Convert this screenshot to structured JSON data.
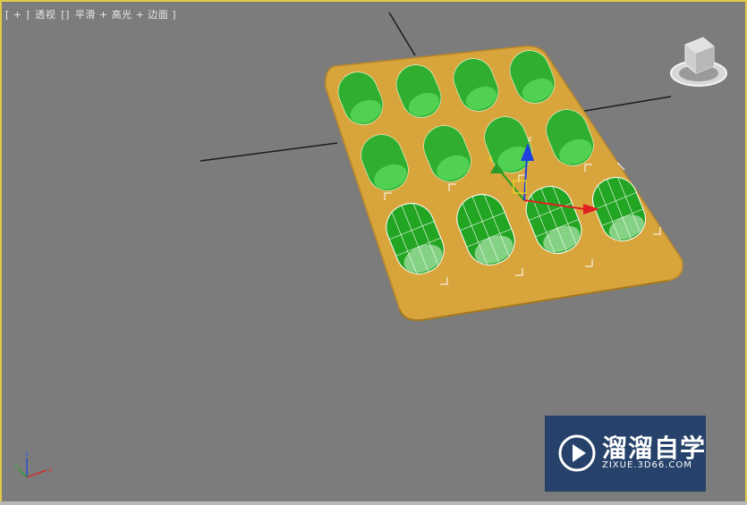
{
  "viewport": {
    "label_parts": [
      "[ + ]",
      "透视",
      "[]",
      "平滑 + 高光 + 边面 ]"
    ],
    "active_border_color": "#e2c84a",
    "background_color": "#7c7c7c"
  },
  "scene": {
    "object": "pill-blister-tray",
    "tray_color": "#d9a63a",
    "pill_color": "#3fc23f",
    "selected_wire_color": "#ffffff",
    "rows": [
      {
        "state": "unselected",
        "count": 4
      },
      {
        "state": "unselected",
        "count": 4
      },
      {
        "state": "selected",
        "count": 4
      }
    ],
    "gizmo": {
      "axes": [
        "x",
        "y",
        "z"
      ],
      "x_color": "#e02020",
      "y_color": "#20a020",
      "z_color": "#2040e0"
    }
  },
  "viewcube": {
    "icon": "viewcube-icon"
  },
  "axis_tripod": {
    "x_label": "x",
    "y_label": "y",
    "z_label": "z"
  },
  "watermark": {
    "title": "溜溜自学",
    "url": "ZIXUE.3D66.COM",
    "background": "#26426a"
  }
}
